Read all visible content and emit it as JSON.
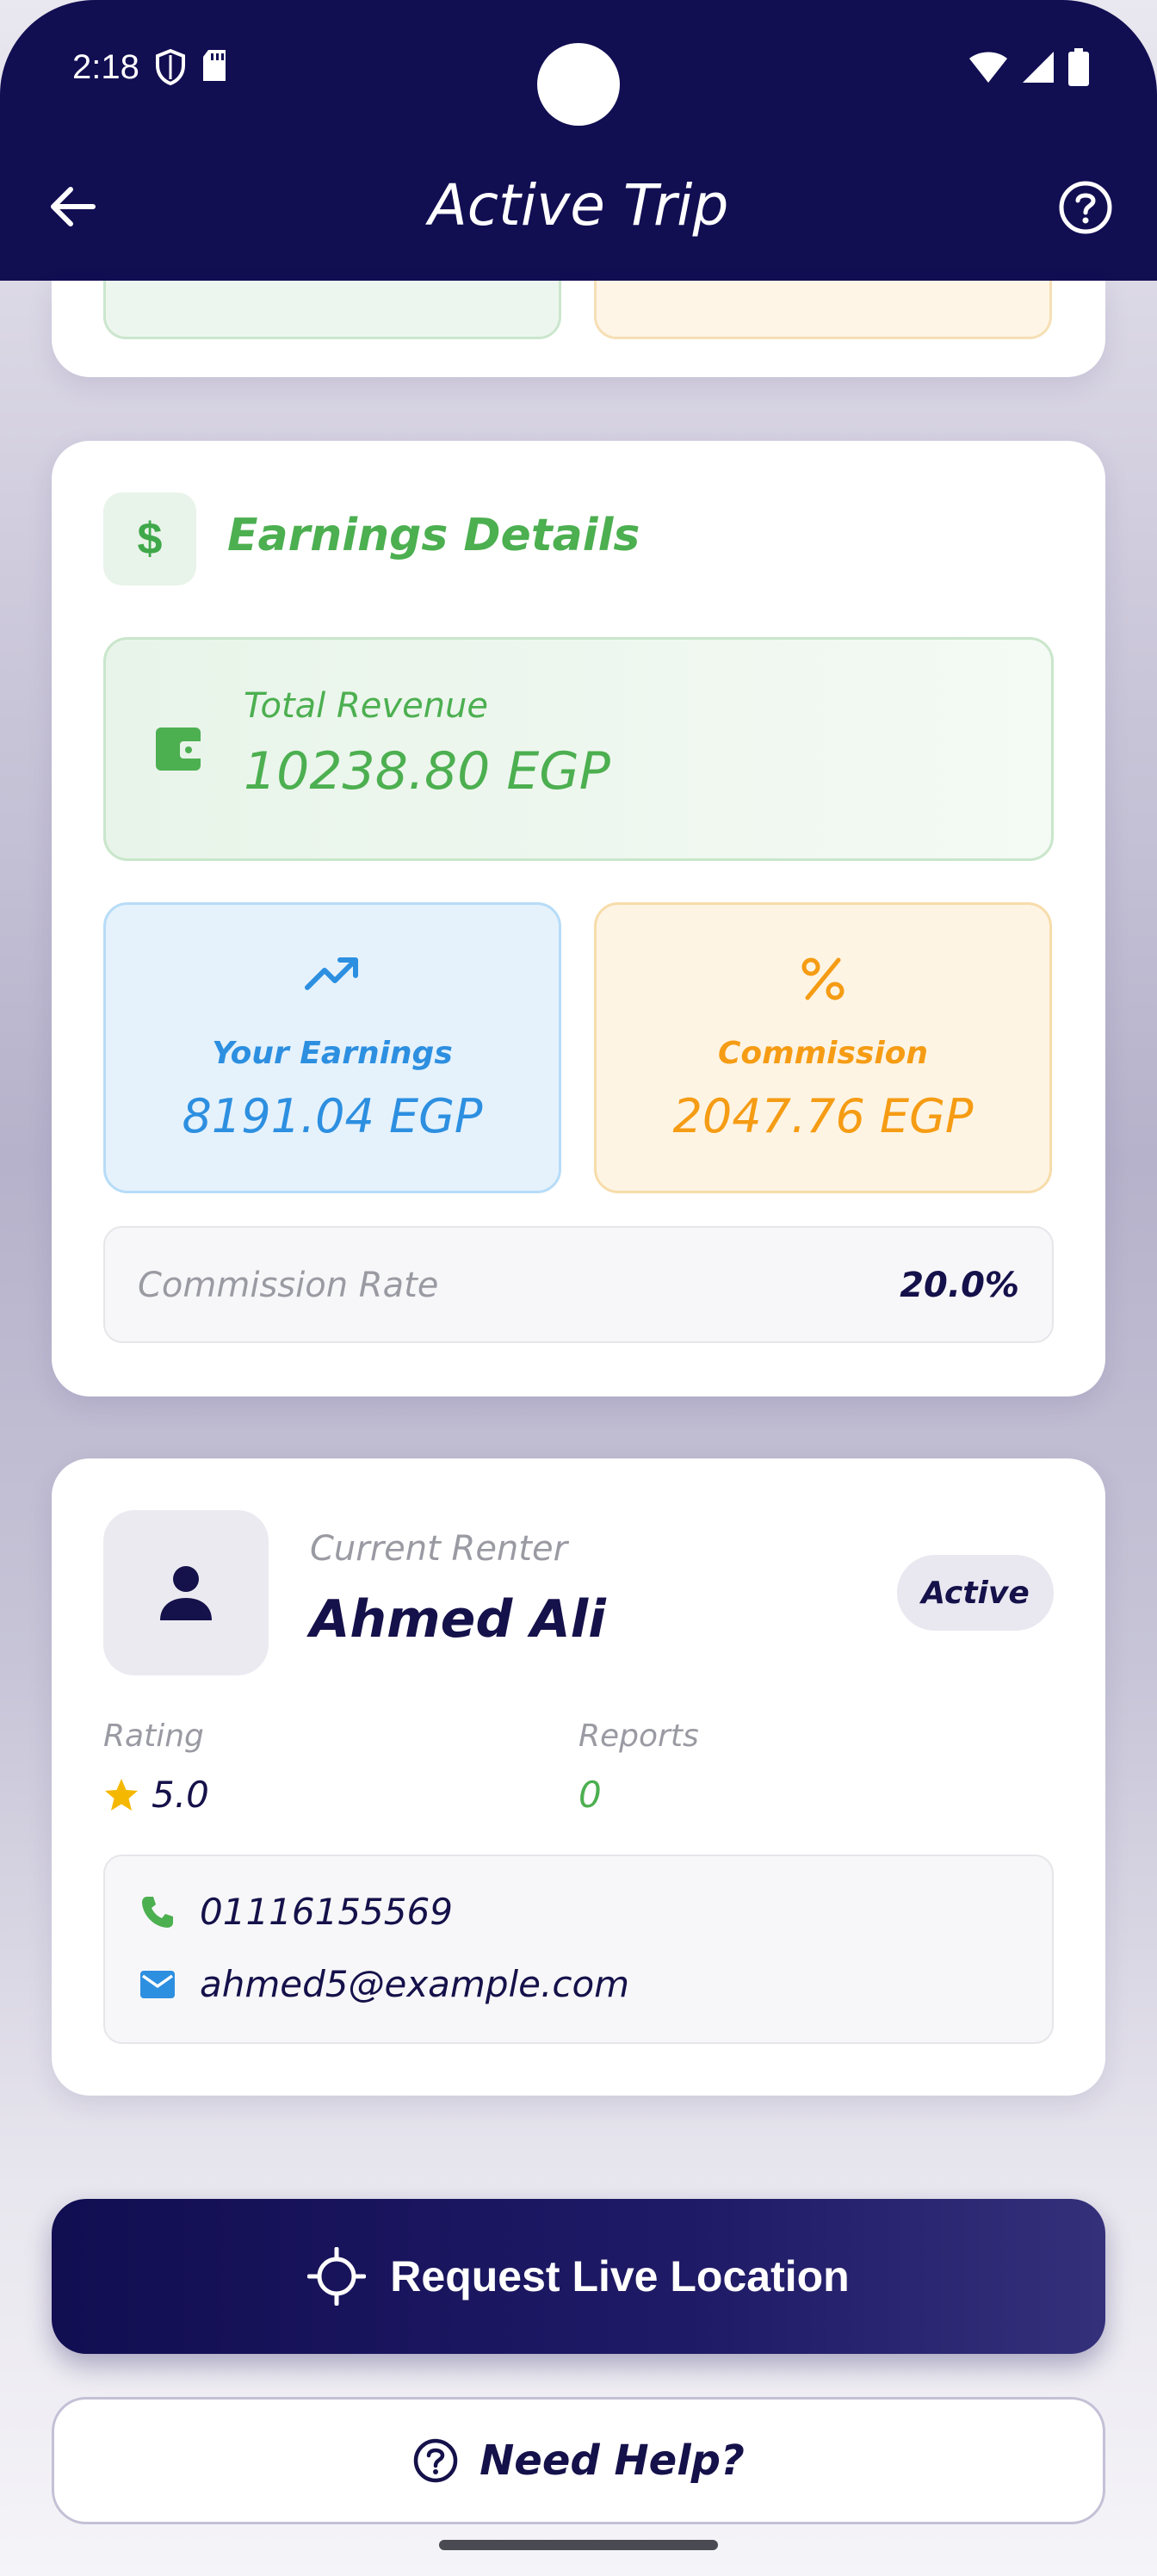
{
  "status_bar": {
    "time": "2:18"
  },
  "app_bar": {
    "title": "Active Trip"
  },
  "earnings": {
    "title": "Earnings Details",
    "total_revenue_label": "Total Revenue",
    "total_revenue_value": "10238.80 EGP",
    "your_earnings_label": "Your Earnings",
    "your_earnings_value": "8191.04 EGP",
    "commission_label": "Commission",
    "commission_value": "2047.76 EGP",
    "commission_rate_label": "Commission Rate",
    "commission_rate_value": "20.0%"
  },
  "renter": {
    "caption": "Current Renter",
    "name": "Ahmed Ali",
    "status": "Active",
    "rating_label": "Rating",
    "rating_value": "5.0",
    "reports_label": "Reports",
    "reports_value": "0",
    "phone": "01116155569",
    "email": "ahmed5@example.com"
  },
  "actions": {
    "request_location": "Request Live Location",
    "need_help": "Need Help?"
  },
  "colors": {
    "primary": "#120e52",
    "green": "#4caf50",
    "blue": "#2d8fe0",
    "orange": "#f59c14",
    "star": "#f5b800"
  }
}
